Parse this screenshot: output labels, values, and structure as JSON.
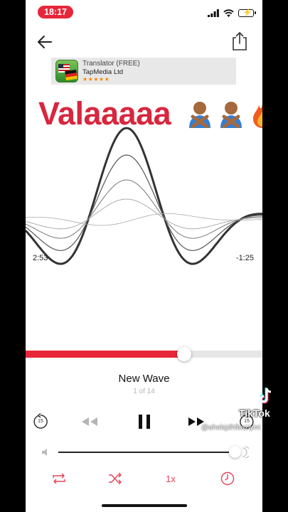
{
  "status_bar": {
    "time": "18:17"
  },
  "ad": {
    "title": "Translator (FREE)",
    "company": "TapMedia Ltd",
    "rating_stars": "★★★★★"
  },
  "caption": {
    "text": "Valaaaaa",
    "emojis": [
      "person-gesturing-no",
      "person-gesturing-no",
      "fire"
    ]
  },
  "player": {
    "elapsed": "2:53",
    "remaining": "-1:25",
    "progress_fraction": 0.67,
    "track_title": "New Wave",
    "track_position": "1 of 14",
    "skip_seconds": "15",
    "speed": "1x",
    "volume_fraction": 0.96
  },
  "overlay": {
    "tiktok_logo": "TikTok",
    "watermark": "@ahelsjdhfbaziyini"
  },
  "colors": {
    "accent": "#e8263a",
    "caption": "#d8263e",
    "background": "#ffffff"
  },
  "icons": {
    "back": "arrow-left-icon",
    "share": "share-icon",
    "rewind": "rewind-icon",
    "pause": "pause-icon",
    "fast_forward": "fast-forward-icon",
    "repeat": "repeat-icon",
    "shuffle": "shuffle-icon",
    "sleep": "clock-icon"
  }
}
